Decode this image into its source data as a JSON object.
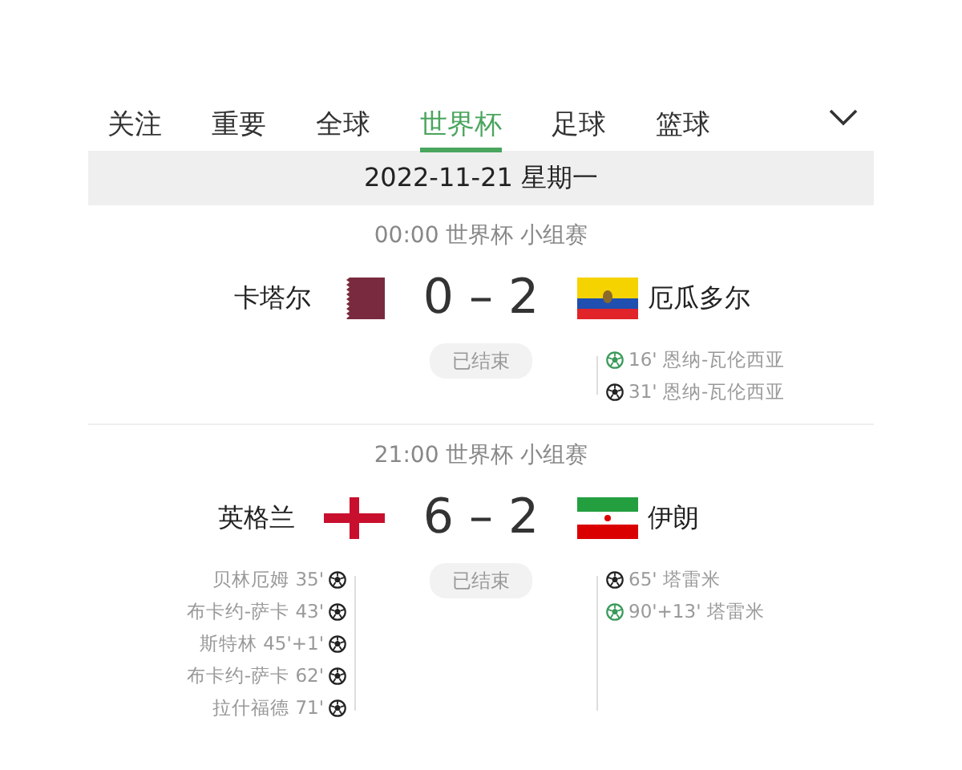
{
  "tabs": [
    {
      "label": "关注",
      "selected": false
    },
    {
      "label": "重要",
      "selected": false
    },
    {
      "label": "全球",
      "selected": false
    },
    {
      "label": "世界杯",
      "selected": true
    },
    {
      "label": "足球",
      "selected": false
    },
    {
      "label": "篮球",
      "selected": false
    }
  ],
  "date": "2022-11-21 星期一",
  "matches": [
    {
      "header": "00:00 世界杯 小组赛",
      "home": {
        "name": "卡塔尔",
        "kind": "qatar"
      },
      "away": {
        "name": "厄瓜多尔",
        "kind": "ecuador"
      },
      "score": "0 – 2",
      "status": "已结束",
      "away_events": [
        {
          "kind": "penalty",
          "text": "16' 恩纳-瓦伦西亚"
        },
        {
          "kind": "goal",
          "text": "31' 恩纳-瓦伦西亚"
        }
      ]
    },
    {
      "header": "21:00 世界杯 小组赛",
      "home": {
        "name": "英格兰",
        "kind": "england"
      },
      "away": {
        "name": "伊朗",
        "kind": "iran"
      },
      "score": "6 – 2",
      "status": "已结束",
      "home_events": [
        {
          "kind": "goal",
          "text": "贝林厄姆 35'"
        },
        {
          "kind": "goal",
          "text": "布卡约-萨卡 43'"
        },
        {
          "kind": "goal",
          "text": "斯特林 45'+1'"
        },
        {
          "kind": "goal",
          "text": "布卡约-萨卡 62'"
        },
        {
          "kind": "goal",
          "text": "拉什福德 71'"
        }
      ],
      "away_events": [
        {
          "kind": "goal",
          "text": "65' 塔雷米"
        },
        {
          "kind": "penalty",
          "text": "90'+13' 塔雷米"
        }
      ]
    }
  ]
}
